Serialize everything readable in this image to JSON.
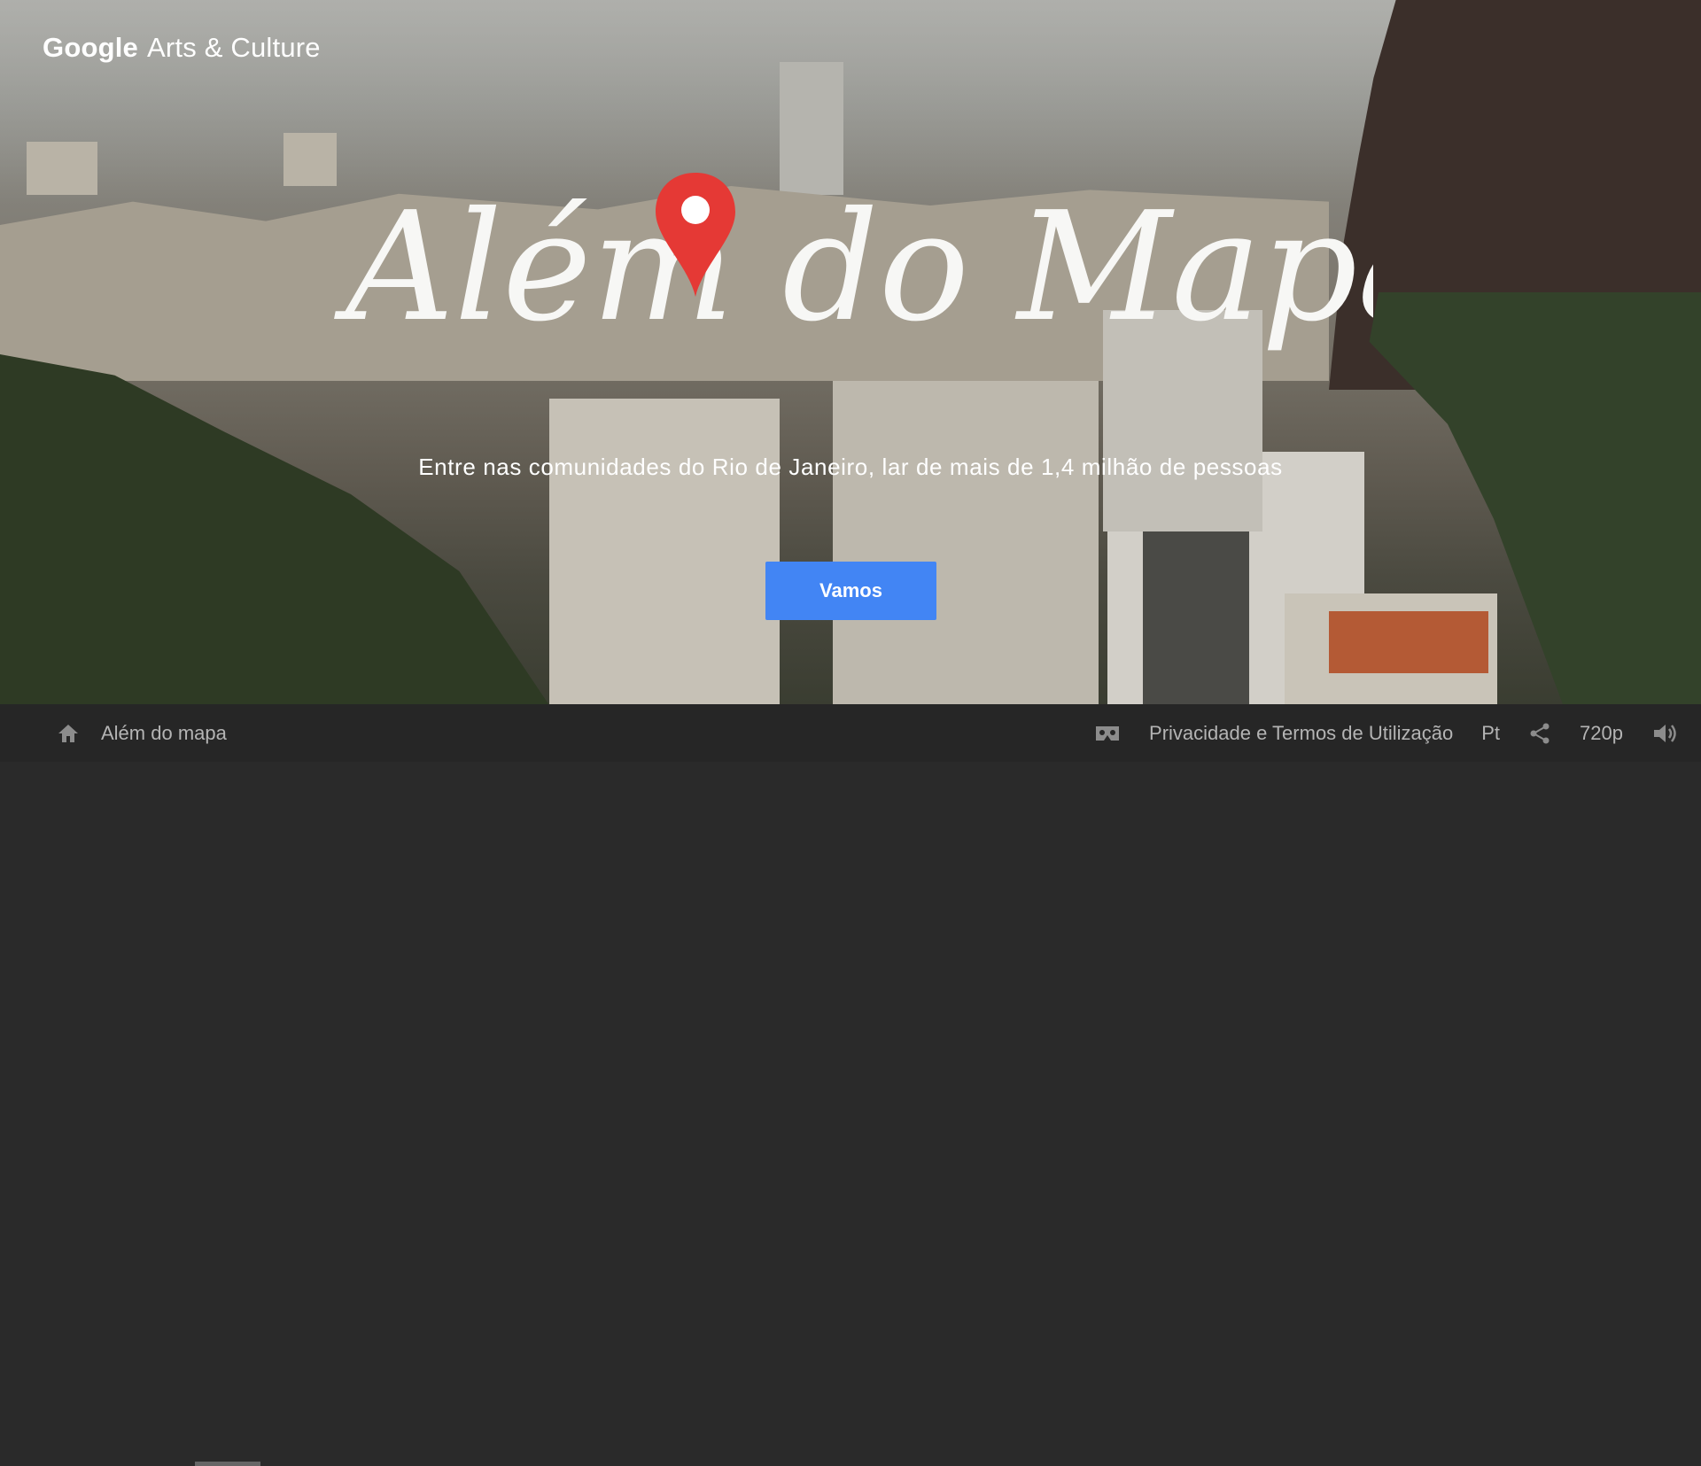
{
  "logo": {
    "google": "Google",
    "product": "Arts & Culture"
  },
  "hero": {
    "title": "Além do Mapa",
    "subtitle": "Entre nas comunidades do Rio de Janeiro, lar de mais de 1,4 milhão de pessoas",
    "cta_label": "Vamos"
  },
  "bottom_bar": {
    "home_icon": "home-icon",
    "page_label": "Além do mapa",
    "vr_icon": "cardboard-vr-icon",
    "privacy_link": "Privacidade e Termos de Utilização",
    "language": "Pt",
    "share_icon": "share-icon",
    "quality": "720p",
    "volume_icon": "volume-icon"
  },
  "colors": {
    "cta": "#4285f4",
    "pin": "#e53935",
    "bar": "#262626"
  }
}
